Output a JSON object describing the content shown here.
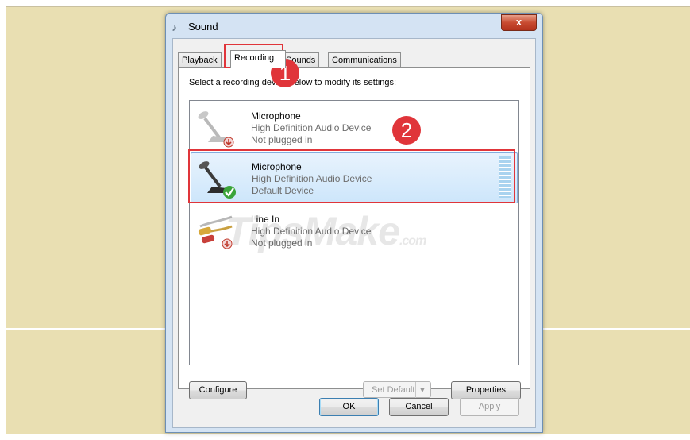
{
  "window": {
    "title": "Sound",
    "close_glyph": "x"
  },
  "tabs": [
    {
      "label": "Playback"
    },
    {
      "label": "Recording"
    },
    {
      "label": "Sounds"
    },
    {
      "label": "Communications"
    }
  ],
  "instruction": "Select a recording device below to modify its settings:",
  "devices": [
    {
      "name": "Microphone",
      "description": "High Definition Audio Device",
      "status": "Not plugged in",
      "icon": "microphone-icon"
    },
    {
      "name": "Microphone",
      "description": "High Definition Audio Device",
      "status": "Default Device",
      "icon": "microphone-icon"
    },
    {
      "name": "Line In",
      "description": "High Definition Audio Device",
      "status": "Not plugged in",
      "icon": "line-in-icon"
    }
  ],
  "buttons": {
    "configure": "Configure",
    "set_default": "Set Default",
    "properties": "Properties",
    "ok": "OK",
    "cancel": "Cancel",
    "apply": "Apply"
  },
  "annotations": {
    "step1": "1",
    "step2": "2"
  },
  "watermark": {
    "main": "TipsMake",
    "suffix": ".com"
  },
  "colors": {
    "highlight": "#e0353a",
    "selection": "#cde6fb",
    "desktop": "#e9dfb2"
  }
}
